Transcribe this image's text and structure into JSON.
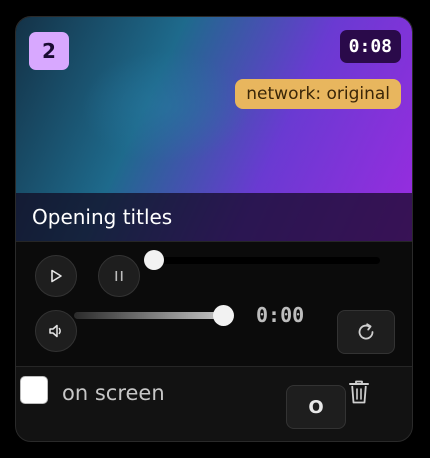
{
  "card": {
    "number_badge": "2",
    "duration_badge": "0:08",
    "network_badge": "network: original",
    "title": "Opening titles"
  },
  "player": {
    "elapsed": "0:00",
    "seek_progress": 0.0,
    "volume_level": 1.0
  },
  "footer": {
    "checkbox_label": "on screen",
    "checkbox_checked": false,
    "o_button_label": "O"
  },
  "icons": {
    "play": "play-icon",
    "pause": "pause-icon",
    "volume": "volume-icon",
    "reload": "reload-icon",
    "trash": "trash-icon"
  },
  "colors": {
    "number_badge_bg": "#d8a8ff",
    "network_badge_bg": "#e8b65e",
    "duration_badge_bg": "#2a0a4a",
    "card_bg": "#121212"
  }
}
